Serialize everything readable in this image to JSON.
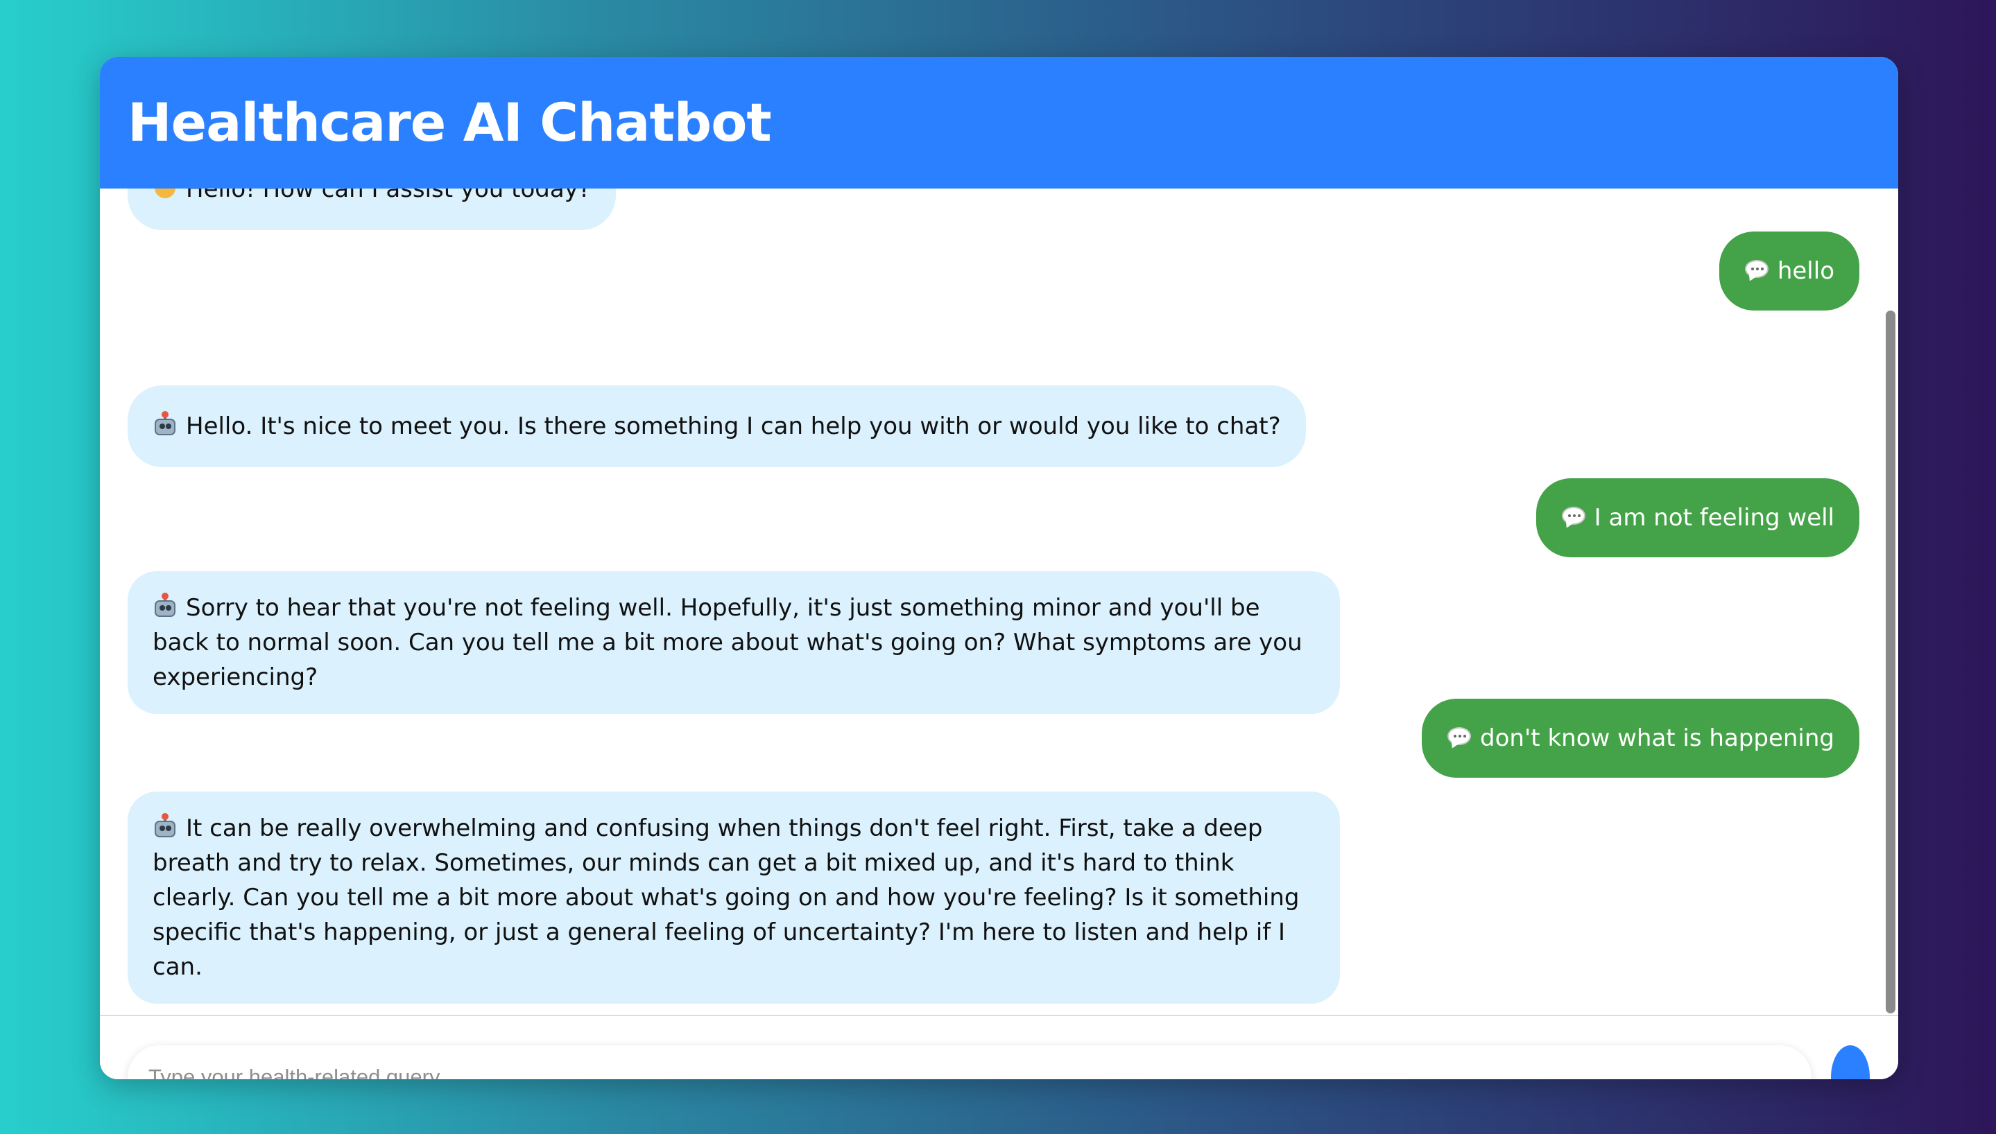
{
  "app": {
    "title": "Healthcare AI Chatbot"
  },
  "messages": [
    {
      "role": "bot",
      "icon": "waving-hand-icon",
      "text": "Hello! How can I assist you today?"
    },
    {
      "role": "user",
      "icon": "speech-bubble-icon",
      "text": "hello"
    },
    {
      "role": "bot",
      "icon": "robot-icon",
      "text": "Hello. It's nice to meet you. Is there something I can help you with or would you like to chat?"
    },
    {
      "role": "user",
      "icon": "speech-bubble-icon",
      "text": "I am not feeling well"
    },
    {
      "role": "bot",
      "icon": "robot-icon",
      "text": "Sorry to hear that you're not feeling well. Hopefully, it's just something minor and you'll be back to normal soon. Can you tell me a bit more about what's going on? What symptoms are you experiencing?"
    },
    {
      "role": "user",
      "icon": "speech-bubble-icon",
      "text": "don't know what is happening"
    },
    {
      "role": "bot",
      "icon": "robot-icon",
      "text": "It can be really overwhelming and confusing when things don't feel right. First, take a deep breath and try to relax. Sometimes, our minds can get a bit mixed up, and it's hard to think clearly. Can you tell me a bit more about what's going on and how you're feeling? Is it something specific that's happening, or just a general feeling of uncertainty? I'm here to listen and help if I can."
    }
  ],
  "composer": {
    "placeholder": "Type your health-related query...",
    "value": ""
  },
  "colors": {
    "header": "#2a80ff",
    "bot_bubble": "#dbf1fd",
    "user_bubble": "#44a348",
    "send_button": "#2a80ff"
  }
}
